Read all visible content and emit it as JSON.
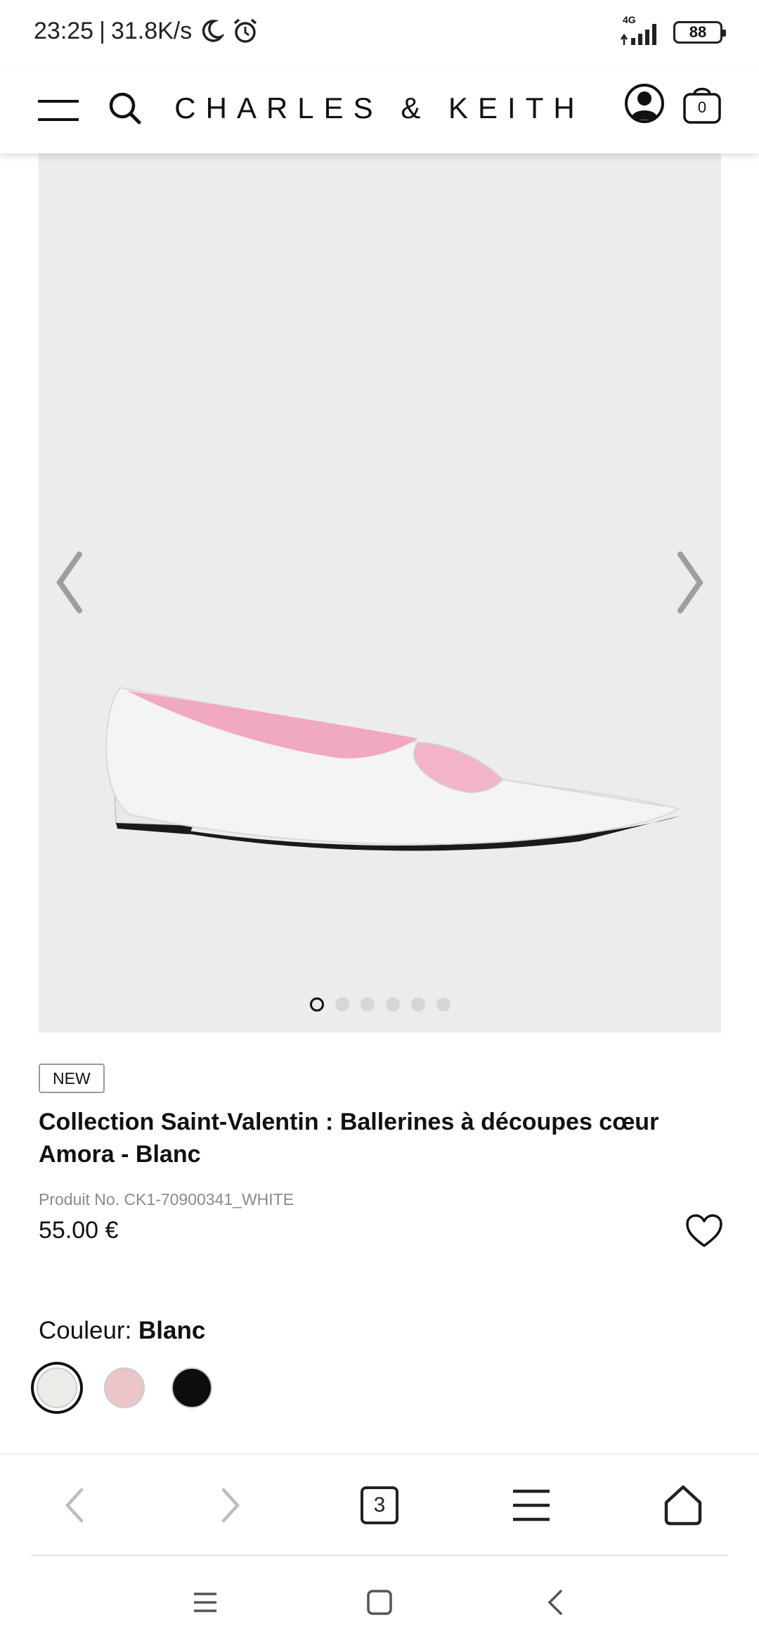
{
  "status_bar": {
    "time": "23:25",
    "separator": "|",
    "speed": "31.8K/s",
    "network": "4G",
    "battery": "88"
  },
  "header": {
    "brand": "CHARLES & KEITH",
    "bag_count": "0"
  },
  "gallery": {
    "image_count": 6,
    "active_index": 0
  },
  "product": {
    "badge": "NEW",
    "title": "Collection Saint-Valentin : Ballerines à découpes cœur Amora - Blanc",
    "product_no": "Produit No. CK1-70900341_WHITE",
    "price": "55.00 €"
  },
  "colour": {
    "label": "Couleur:",
    "selected": "Blanc",
    "swatches": [
      {
        "color": "#ebebe7",
        "selected": true
      },
      {
        "color": "#ebc6c8",
        "selected": false
      },
      {
        "color": "#0d0d0d",
        "selected": false
      }
    ]
  },
  "browser_bar": {
    "tab_count": "3"
  },
  "colors": {
    "image_bg": "#ececec",
    "text": "#111111",
    "muted": "#8a8a8a"
  }
}
